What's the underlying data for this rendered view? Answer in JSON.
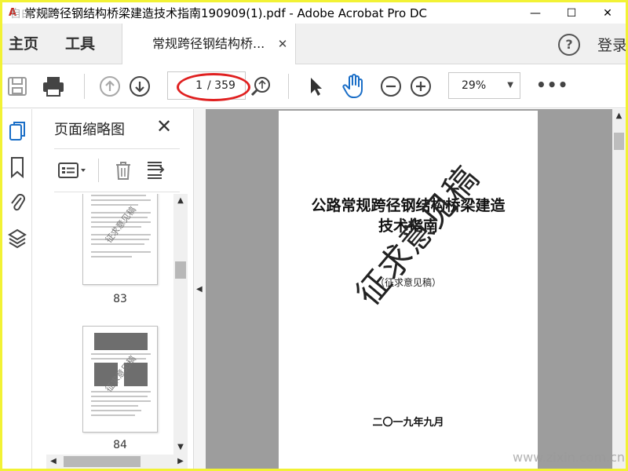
{
  "window": {
    "title": "常规跨径钢结构桥梁建造技术指南190909(1).pdf - Adobe Acrobat Pro DC",
    "icon": "acrobat-icon",
    "minimize": "—",
    "maximize": "☐",
    "close": "✕"
  },
  "nav": {
    "home": "主页",
    "tools": "工具",
    "doc_tab": "常规跨径钢结构桥...",
    "help": "?",
    "login": "登录"
  },
  "toolbar": {
    "page_current": "1",
    "page_total": "/ 359",
    "zoom": "29%",
    "more": "•••"
  },
  "thumbnails": {
    "title": "页面缩略图",
    "watermark": "征求意见稿",
    "pages": [
      "83",
      "84"
    ]
  },
  "document": {
    "title_line1": "公路常规跨径钢结构桥梁建造",
    "title_line2": "技术指南",
    "subtitle": "（征求意见稿）",
    "watermark": "征求意见稿",
    "date": "二〇一九年九月"
  },
  "site_watermark": {
    "top": "自由下载",
    "bottom": "www.zixin.com.cn"
  },
  "colors": {
    "frame": "#f2f235",
    "accent_blue": "#1a6ec7",
    "annotation_red": "#e02020"
  }
}
